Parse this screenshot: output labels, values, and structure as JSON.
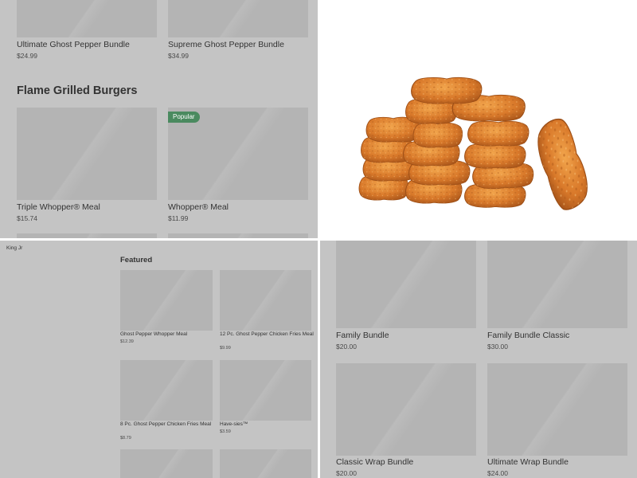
{
  "menu_top": {
    "bundles": [
      {
        "name": "Ultimate Ghost Pepper Bundle",
        "price": "$24.99"
      },
      {
        "name": "Supreme Ghost Pepper Bundle",
        "price": "$34.99"
      }
    ],
    "section_title": "Flame Grilled Burgers",
    "items": [
      {
        "name": "Triple Whopper® Meal",
        "price": "$15.74"
      },
      {
        "name": "Whopper® Meal",
        "price": "$11.99",
        "badge": "Popular"
      }
    ]
  },
  "featured": {
    "store_name": "King Jr",
    "title": "Featured",
    "items": [
      {
        "name": "Ghost Pepper Whopper Meal",
        "price": "$12.39"
      },
      {
        "name": "12 Pc. Ghost Pepper Chicken Fries Meal",
        "price": "$9.99"
      },
      {
        "name": "8 Pc. Ghost Pepper Chicken Fries Meal",
        "price": "$8.79"
      },
      {
        "name": "Have-sies™",
        "price": "$3.59"
      }
    ]
  },
  "bundles": {
    "items": [
      {
        "name": "Family Bundle",
        "price": "$20.00"
      },
      {
        "name": "Family Bundle Classic",
        "price": "$30.00"
      },
      {
        "name": "Classic Wrap Bundle",
        "price": "$20.00"
      },
      {
        "name": "Ultimate Wrap Bundle",
        "price": "$24.00"
      }
    ]
  },
  "colors": {
    "panel_bg": "#c4c4c4",
    "placeholder": "#b4b4b4",
    "badge_bg": "#4a8a5f",
    "text": "#333333"
  }
}
